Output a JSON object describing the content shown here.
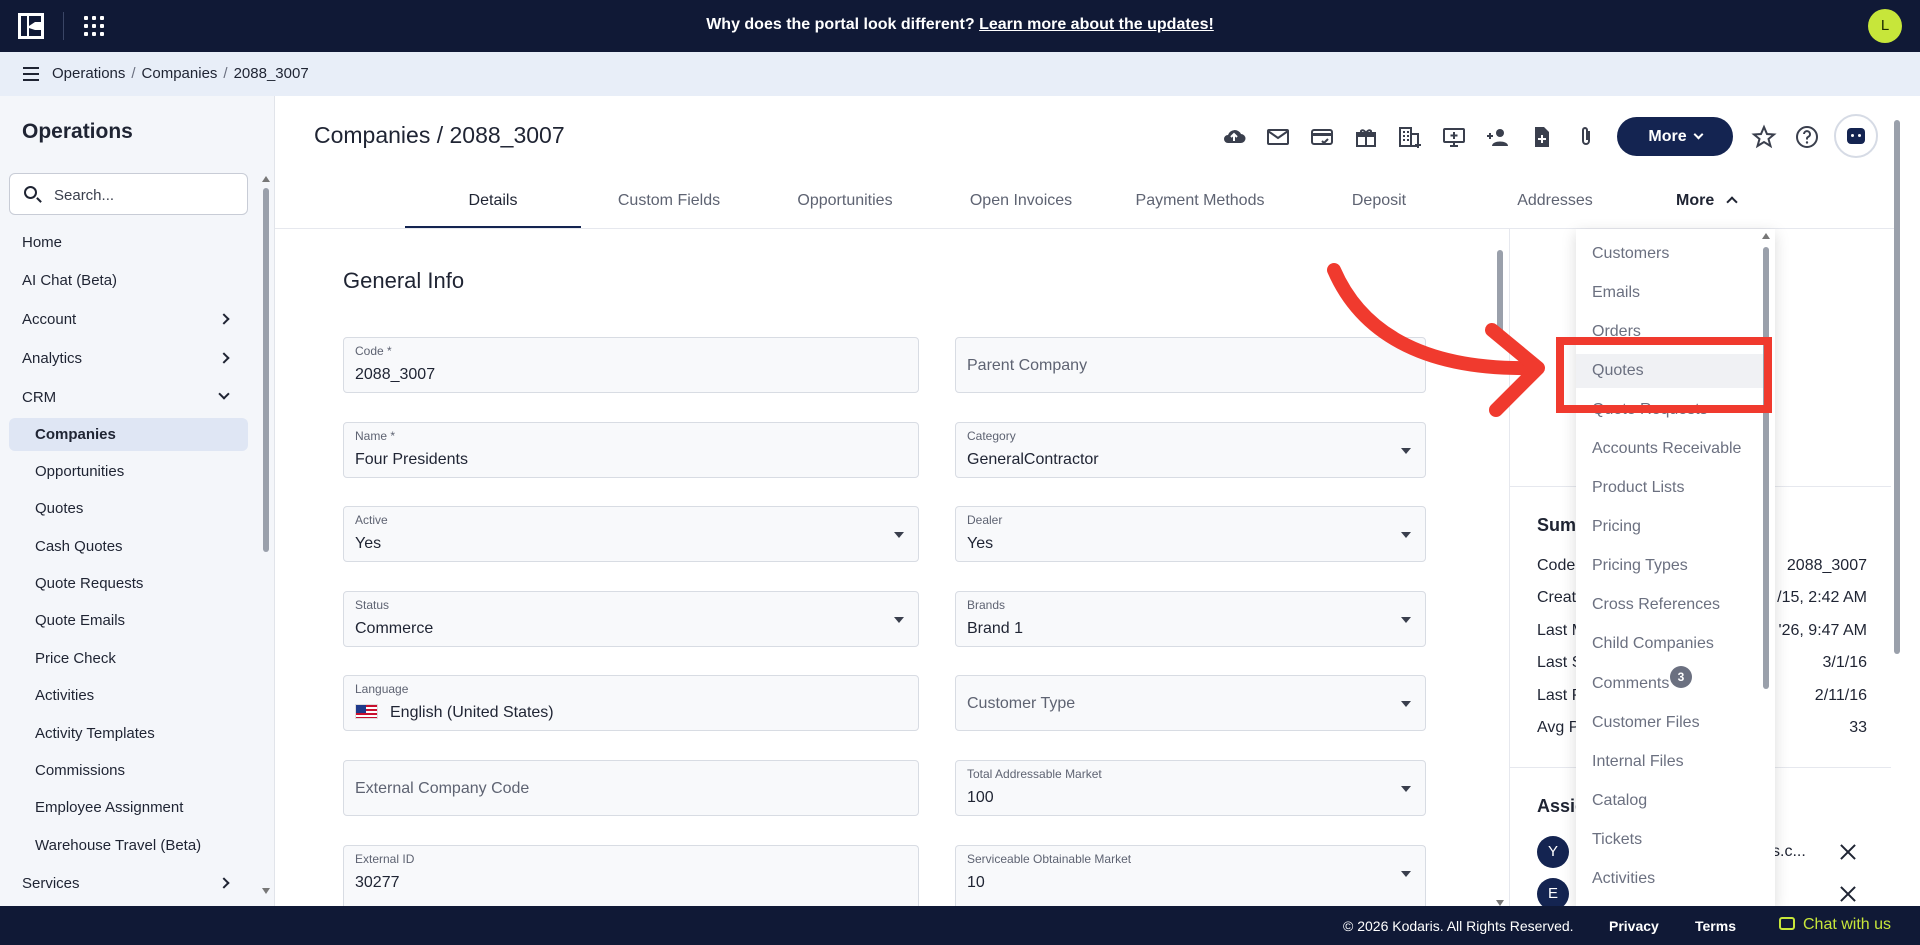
{
  "banner": {
    "text": "Why does the portal look different?",
    "link": "Learn more about the updates!",
    "user_initial": "L"
  },
  "breadcrumb": [
    "Operations",
    "Companies",
    "2088_3007"
  ],
  "sidebar": {
    "title": "Operations",
    "search_placeholder": "Search...",
    "items": [
      {
        "label": "Home"
      },
      {
        "label": "AI Chat (Beta)"
      },
      {
        "label": "Account"
      },
      {
        "label": "Analytics"
      },
      {
        "label": "CRM"
      },
      {
        "label": "Companies"
      },
      {
        "label": "Opportunities"
      },
      {
        "label": "Quotes"
      },
      {
        "label": "Cash Quotes"
      },
      {
        "label": "Quote Requests"
      },
      {
        "label": "Quote Emails"
      },
      {
        "label": "Price Check"
      },
      {
        "label": "Activities"
      },
      {
        "label": "Activity Templates"
      },
      {
        "label": "Commissions"
      },
      {
        "label": "Employee Assignment"
      },
      {
        "label": "Warehouse Travel (Beta)"
      },
      {
        "label": "Services"
      }
    ]
  },
  "page": {
    "title": "Companies / 2088_3007",
    "more_button": "More",
    "toolbar_icons": [
      "cloud-upload-icon",
      "mail-icon",
      "card-check-icon",
      "gift-icon",
      "building-add-icon",
      "screen-add-icon",
      "person-add-icon",
      "document-add-icon",
      "paperclip-icon"
    ]
  },
  "tabs": [
    "Details",
    "Custom Fields",
    "Opportunities",
    "Open Invoices",
    "Payment Methods",
    "Deposit",
    "Addresses"
  ],
  "tab_more": "More",
  "form": {
    "section_title": "General Info",
    "code_label": "Code *",
    "code_value": "2088_3007",
    "parent_placeholder": "Parent Company",
    "name_label": "Name *",
    "name_value": "Four Presidents",
    "category_label": "Category",
    "category_value": "GeneralContractor",
    "active_label": "Active",
    "active_value": "Yes",
    "dealer_label": "Dealer",
    "dealer_value": "Yes",
    "status_label": "Status",
    "status_value": "Commerce",
    "brands_label": "Brands",
    "brands_value": "Brand 1",
    "language_label": "Language",
    "language_value": "English (United States)",
    "customer_type_placeholder": "Customer Type",
    "external_code_placeholder": "External Company Code",
    "tam_label": "Total Addressable Market",
    "tam_value": "100",
    "external_id_label": "External ID",
    "external_id_value": "30277",
    "som_label": "Serviceable Obtainable Market",
    "som_value": "10"
  },
  "right_panel": {
    "summary_heading": "Sum",
    "rows": [
      {
        "k": "Code",
        "v": "2088_3007"
      },
      {
        "k": "Creat",
        "v": "/15, 2:42 AM"
      },
      {
        "k": "Last M",
        "v": "'26, 9:47 AM"
      },
      {
        "k": "Last S",
        "v": "3/1/16"
      },
      {
        "k": "Last P",
        "v": "2/11/16"
      },
      {
        "k": "Avg P",
        "v": "33"
      }
    ],
    "assign_heading": "Assig",
    "assignees": [
      {
        "initial": "Y",
        "text": "s.c..."
      },
      {
        "initial": "E",
        "text": ""
      }
    ]
  },
  "menu": {
    "items": [
      "Customers",
      "Emails",
      "Orders",
      "Quotes",
      "Quote Requests",
      "Accounts Receivable",
      "Product Lists",
      "Pricing",
      "Pricing Types",
      "Cross References",
      "Child Companies",
      "Comments",
      "Customer Files",
      "Internal Files",
      "Catalog",
      "Tickets",
      "Activities"
    ],
    "highlighted": "Quotes",
    "comments_badge": "3"
  },
  "footer": {
    "copyright": "© 2026 Kodaris. All Rights Reserved.",
    "privacy": "Privacy",
    "terms": "Terms",
    "chat": "Chat with us"
  },
  "colors": {
    "navy": "#101936",
    "brand_button": "#142451",
    "accent_lime": "#c7e63a",
    "annotation_red": "#f03a2e"
  }
}
